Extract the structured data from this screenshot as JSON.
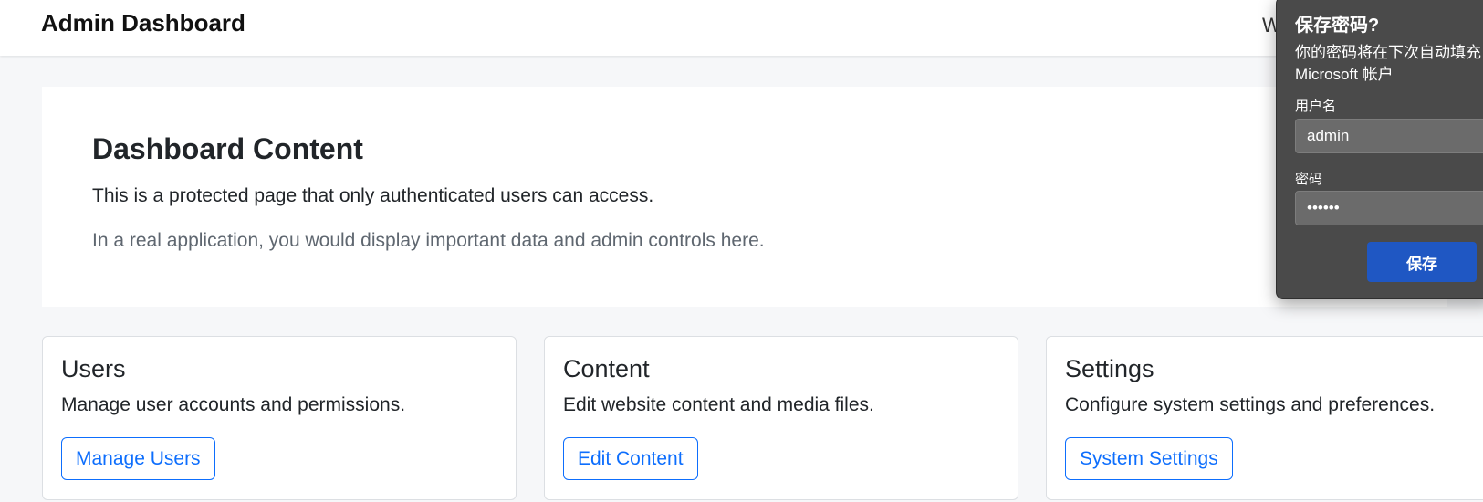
{
  "header": {
    "title": "Admin Dashboard",
    "welcome_text": "W"
  },
  "hero": {
    "title": "Dashboard Content",
    "lead": "This is a protected page that only authenticated users can access.",
    "muted": "In a real application, you would display important data and admin controls here."
  },
  "cards": [
    {
      "title": "Users",
      "text": "Manage user accounts and permissions.",
      "button": "Manage Users"
    },
    {
      "title": "Content",
      "text": "Edit website content and media files.",
      "button": "Edit Content"
    },
    {
      "title": "Settings",
      "text": "Configure system settings and preferences.",
      "button": "System Settings"
    }
  ],
  "password_popup": {
    "title": "保存密码?",
    "description": "你的密码将在下次自动填充 Microsoft 帐户",
    "username_label": "用户名",
    "username_value": "admin",
    "password_label": "密码",
    "password_value": "••••••",
    "save_label": "保存"
  },
  "colors": {
    "primary": "#0d6efd",
    "popup_bg": "#4a4a4a",
    "popup_button": "#1f57c3",
    "page_bg": "#f6f7f9"
  }
}
